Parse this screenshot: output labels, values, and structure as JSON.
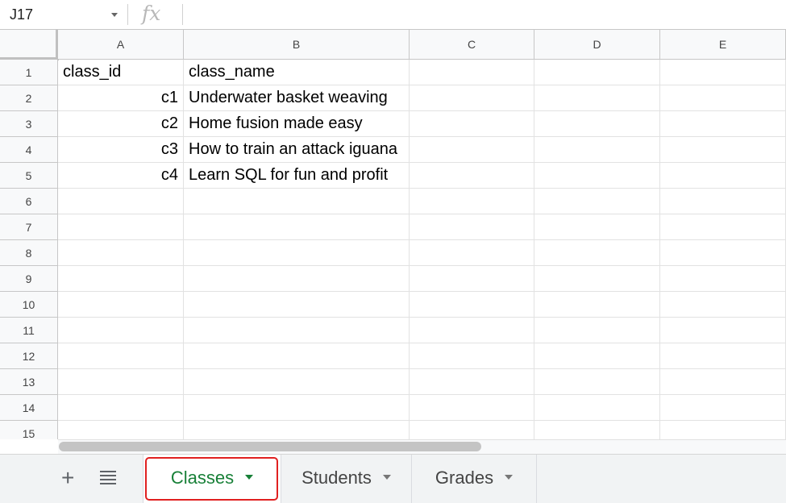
{
  "formula_bar": {
    "cell_reference": "J17",
    "fx_label": "fx",
    "formula_value": ""
  },
  "columns": [
    "A",
    "B",
    "C",
    "D",
    "E"
  ],
  "row_numbers": [
    "1",
    "2",
    "3",
    "4",
    "5",
    "6",
    "7",
    "8",
    "9",
    "10",
    "11",
    "12",
    "13",
    "14",
    "15"
  ],
  "cells": {
    "A1": "class_id",
    "B1": "class_name",
    "A2": "c1",
    "B2": "Underwater basket weaving",
    "A3": "c2",
    "B3": "Home fusion made easy",
    "A4": "c3",
    "B4": "How to train an attack iguana",
    "A5": "c4",
    "B5": "Learn SQL for fun and profit"
  },
  "tabs": [
    {
      "label": "Classes",
      "active": true
    },
    {
      "label": "Students",
      "active": false
    },
    {
      "label": "Grades",
      "active": false
    }
  ],
  "tab_controls": {
    "add_icon": "+"
  },
  "colors": {
    "active_tab_text": "#188038",
    "highlight_border": "#e02020"
  }
}
